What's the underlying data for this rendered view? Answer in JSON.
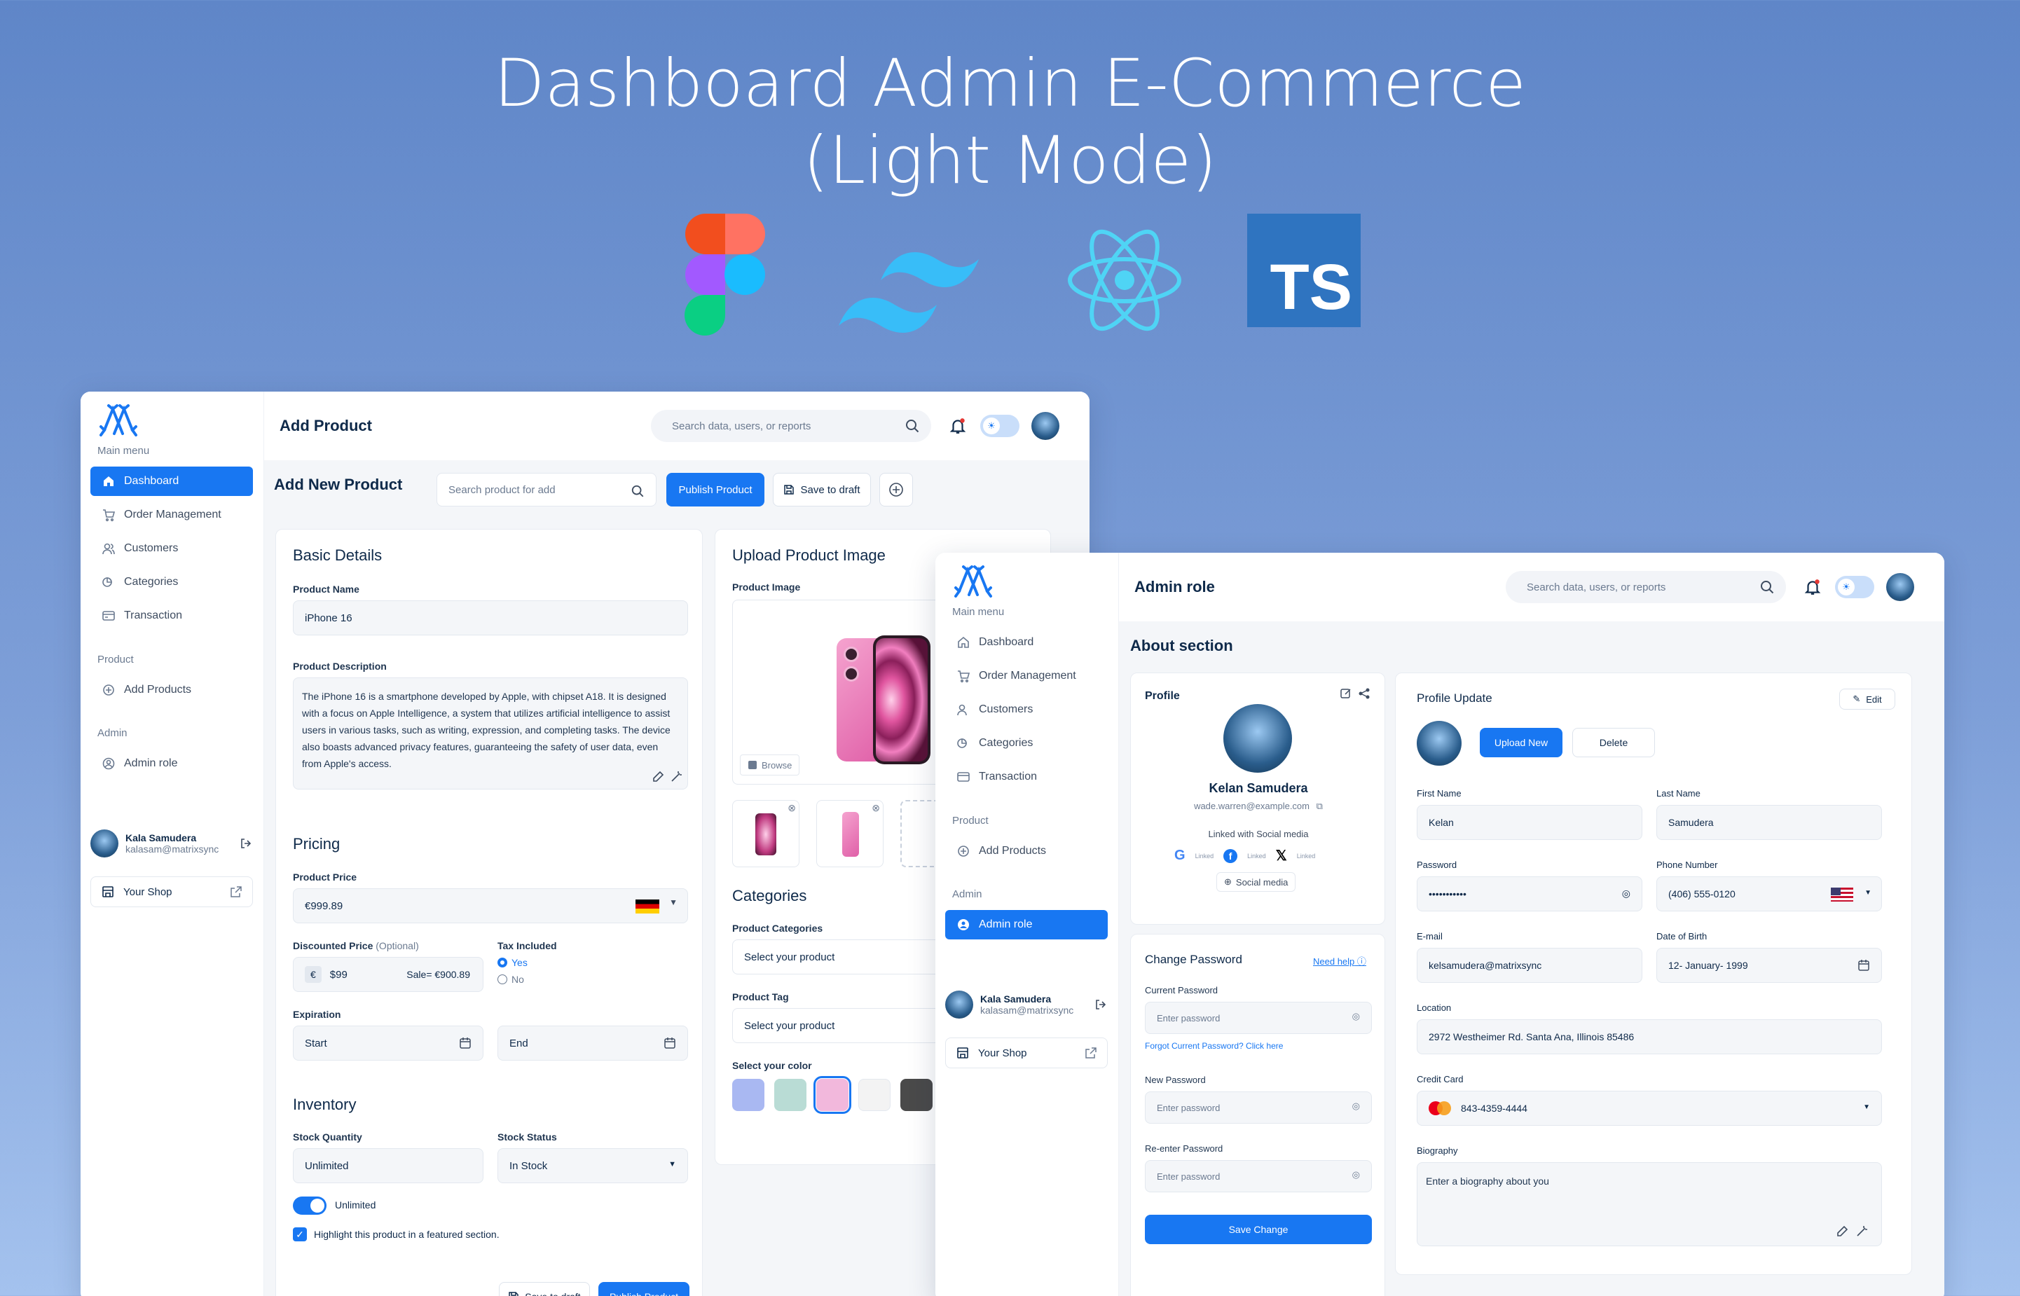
{
  "hero": {
    "title_line1": "Dashboard Admin E-Commerce",
    "title_line2": "(Light Mode)"
  },
  "tech_logos": [
    "figma-logo",
    "tailwind-logo",
    "react-logo",
    "typescript-logo"
  ],
  "ts_logo_text": "TS",
  "colors": {
    "accent": "#1877f2",
    "page_bg": "#f4f6f9",
    "text": "#0f2a4a"
  },
  "sidebar": {
    "main_menu_label": "Main menu",
    "items": [
      {
        "label": "Dashboard",
        "icon": "home-icon"
      },
      {
        "label": "Order Management",
        "icon": "cart-icon"
      },
      {
        "label": "Customers",
        "icon": "users-icon"
      },
      {
        "label": "Categories",
        "icon": "categories-icon"
      },
      {
        "label": "Transaction",
        "icon": "card-icon"
      }
    ],
    "product_label": "Product",
    "add_products": "Add Products",
    "admin_label": "Admin",
    "admin_role": "Admin role",
    "user": {
      "name": "Kala Samudera",
      "email": "kalasam@matrixsync"
    },
    "shop": "Your Shop"
  },
  "p1": {
    "title": "Add Product",
    "search_placeholder": "Search data, users, or reports",
    "section_title": "Add New Product",
    "search_product_placeholder": "Search product for add",
    "publish": "Publish Product",
    "save_draft": "Save to draft",
    "basic": {
      "title": "Basic Details",
      "name_label": "Product Name",
      "name_value": "iPhone 16",
      "desc_label": "Product Description",
      "desc_value": "The iPhone 16 is a smartphone developed by Apple, with chipset A18. It is designed with a focus on Apple Intelligence, a system that utilizes artificial intelligence to assist users in various tasks, such as writing, expression, and completing tasks. The device also boasts advanced privacy features, guaranteeing the safety of user data, even from Apple's access."
    },
    "pricing": {
      "title": "Pricing",
      "price_label": "Product Price",
      "price_value": "€999.89",
      "discount_label": "Discounted Price",
      "discount_optional": "(Optional)",
      "currency": "€",
      "discount_value": "$99",
      "sale": "Sale= €900.89",
      "tax_label": "Tax Included",
      "tax_yes": "Yes",
      "tax_no": "No",
      "expiration_label": "Expiration",
      "start": "Start",
      "end": "End"
    },
    "inventory": {
      "title": "Inventory",
      "qty_label": "Stock Quantity",
      "qty_value": "Unlimited",
      "status_label": "Stock Status",
      "status_value": "In Stock",
      "unlimited_toggle": "Unlimited",
      "highlight": "Highlight this product in a featured section."
    },
    "upload": {
      "title": "Upload Product Image",
      "image_label": "Product Image",
      "browse": "Browse"
    },
    "categories": {
      "title": "Categories",
      "cat_label": "Product Categories",
      "cat_placeholder": "Select your product",
      "tag_label": "Product Tag",
      "tag_placeholder": "Select your product",
      "color_label": "Select your color",
      "colors": [
        "#a9b8f2",
        "#b9dcd5",
        "#f2b8dc",
        "#f3f3f3",
        "#4a4a4a"
      ]
    }
  },
  "p2": {
    "title": "Admin role",
    "search_placeholder": "Search data, users, or reports",
    "section_title": "About section",
    "profile": {
      "title": "Profile",
      "name": "Kelan Samudera",
      "email": "wade.warren@example.com",
      "linked": "Linked with Social media",
      "linked_small": "Linked",
      "social_btn": "Social media"
    },
    "password": {
      "title": "Change Password",
      "need_help": "Need help",
      "current": "Current Password",
      "placeholder": "Enter password",
      "forgot": "Forgot Current Password? Click here",
      "new": "New Password",
      "reenter": "Re-enter Password",
      "save": "Save Change"
    },
    "update": {
      "title": "Profile Update",
      "edit": "Edit",
      "upload": "Upload New",
      "delete": "Delete",
      "first_label": "First Name",
      "first": "Kelan",
      "last_label": "Last Name",
      "last": "Samudera",
      "pass_label": "Password",
      "pass": "•••••••••••",
      "phone_label": "Phone Number",
      "phone": "(406) 555-0120",
      "email_label": "E-mail",
      "email": "kelsamudera@matrixsync",
      "dob_label": "Date of Birth",
      "dob": "12- January- 1999",
      "loc_label": "Location",
      "loc": "2972 Westheimer Rd. Santa Ana, Illinois 85486",
      "cc_label": "Credit Card",
      "cc": "843-4359-4444",
      "bio_label": "Biography",
      "bio_placeholder": "Enter a biography about you"
    }
  }
}
